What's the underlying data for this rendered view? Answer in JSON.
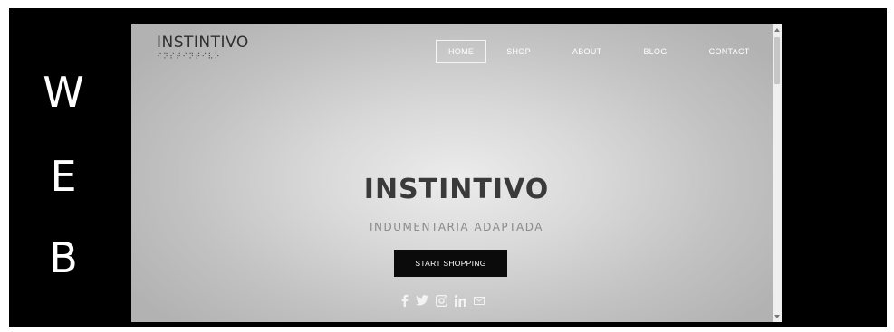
{
  "side_letters": [
    "W",
    "E",
    "B"
  ],
  "site": {
    "logo": {
      "text": "INSTINTIVO",
      "braille": "⠊⠝⠎⠞⠊⠝⠞⠊⠧⠕"
    },
    "nav": {
      "items": [
        "HOME",
        "SHOP",
        "ABOUT",
        "BLOG",
        "CONTACT"
      ],
      "active": "HOME"
    },
    "hero": {
      "title": "INSTINTIVO",
      "subtitle": "INDUMENTARIA ADAPTADA",
      "button_label": "START SHOPPING"
    },
    "social_icons": [
      "facebook-icon",
      "twitter-icon",
      "instagram-icon",
      "linkedin-icon",
      "email-icon"
    ]
  },
  "colors": {
    "frame_background": "#000000",
    "cta_background": "#0b0b0b",
    "nav_text": "#ffffff"
  }
}
